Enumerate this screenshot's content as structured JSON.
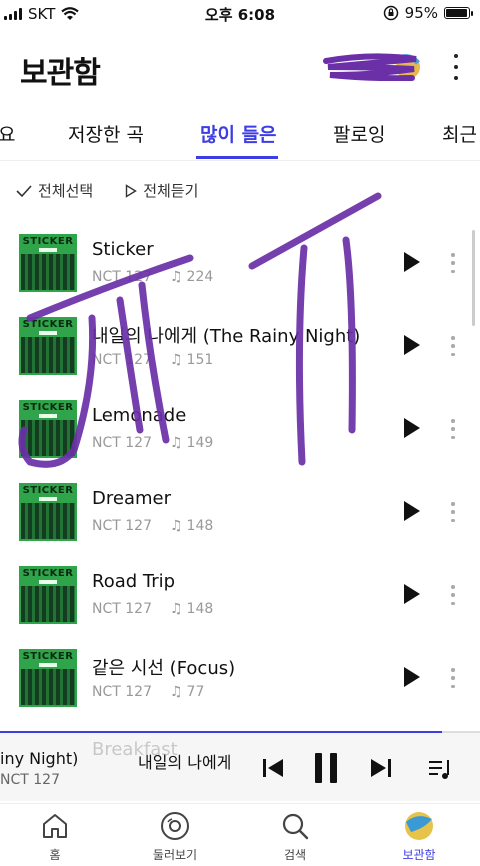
{
  "status_bar": {
    "carrier": "SKT",
    "time": "오후 6:08",
    "battery_percent": "95%",
    "battery_level": 0.95
  },
  "header": {
    "title": "보관함"
  },
  "tabs": [
    {
      "label": "요"
    },
    {
      "label": "저장한 곡"
    },
    {
      "label": "많이 들은"
    },
    {
      "label": "팔로잉"
    },
    {
      "label": "최근"
    }
  ],
  "active_tab": "많이 들은",
  "actions": {
    "select_all": "전체선택",
    "play_all": "전체듣기"
  },
  "album_art": {
    "title": "STICKER"
  },
  "songs": [
    {
      "title": "Sticker",
      "artist": "NCT 127",
      "plays": "224"
    },
    {
      "title": "내일의 나에게 (The Rainy Night)",
      "artist": "NCT 127",
      "plays": "151"
    },
    {
      "title": "Lemonade",
      "artist": "NCT 127",
      "plays": "149"
    },
    {
      "title": "Dreamer",
      "artist": "NCT 127",
      "plays": "148"
    },
    {
      "title": "Road Trip",
      "artist": "NCT 127",
      "plays": "148"
    },
    {
      "title": "같은 시선 (Focus)",
      "artist": "NCT 127",
      "plays": "77"
    }
  ],
  "mini_player": {
    "ghost_title": "Breakfast",
    "title_scroll_a": "iny Night)",
    "title_scroll_b": "내일의 나에게",
    "artist": "NCT 127",
    "progress": 0.92
  },
  "bottom_nav": [
    {
      "label": "홈",
      "icon": "home-icon"
    },
    {
      "label": "둘러보기",
      "icon": "browse-disc-icon"
    },
    {
      "label": "검색",
      "icon": "search-icon"
    },
    {
      "label": "보관함",
      "icon": "library-profile-icon"
    }
  ],
  "colors": {
    "accent": "#3d3de6",
    "album_green": "#2fa44a",
    "scribble_purple": "#6b2fa8"
  }
}
